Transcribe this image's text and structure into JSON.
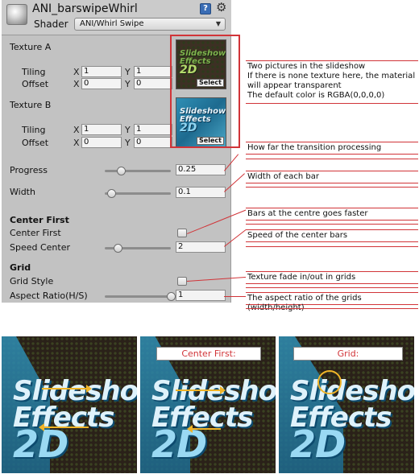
{
  "header": {
    "title": "ANI_barswipeWhirl",
    "shader_label": "Shader",
    "shader_value": "ANI/Whirl Swipe",
    "help_icon": "help-book-icon",
    "gear_icon": "gear-icon"
  },
  "texture_a": {
    "label": "Texture A",
    "tiling_label": "Tiling",
    "offset_label": "Offset",
    "axis_x": "X",
    "axis_y": "Y",
    "tiling_x": "1",
    "tiling_y": "1",
    "offset_x": "0",
    "offset_y": "0",
    "select_label": "Select",
    "thumb_text": "Slideshow Effects",
    "thumb_number": "2D"
  },
  "texture_b": {
    "label": "Texture B",
    "tiling_label": "Tiling",
    "offset_label": "Offset",
    "axis_x": "X",
    "axis_y": "Y",
    "tiling_x": "1",
    "tiling_y": "1",
    "offset_x": "0",
    "offset_y": "0",
    "select_label": "Select",
    "thumb_text": "Slideshow Effects",
    "thumb_number": "2D"
  },
  "progress": {
    "label": "Progress",
    "value": "0.25",
    "fraction": 0.25
  },
  "width": {
    "label": "Width",
    "value": "0.1",
    "fraction": 0.1
  },
  "center_first": {
    "section": "Center First",
    "toggle_label": "Center First",
    "speed_label": "Speed Center",
    "speed_value": "2",
    "speed_fraction": 0.2
  },
  "grid": {
    "section": "Grid",
    "style_label": "Grid Style",
    "aspect_label": "Aspect Ratio(H/S)",
    "aspect_value": "1",
    "aspect_fraction": 1.0
  },
  "notes": {
    "textures": "Two pictures in the slideshow\nIf there is none texture here, the material will appear transparent\nThe default color is RGBA(0,0,0,0)",
    "progress": "How far the transition processing",
    "width": "Width of each bar",
    "center_first": "Bars at the centre goes faster",
    "speed_center": "Speed of the center bars",
    "grid_style": "Texture fade in/out in grids",
    "aspect": "The aspect ratio of the grids (width/height)"
  },
  "previews": {
    "caption_center": "Center First:",
    "caption_grid": "Grid:",
    "logo_text": "Slideshow Effects",
    "logo_number": "2D"
  },
  "colors": {
    "annotation": "#d13438",
    "arrow": "#f0b428",
    "panel": "#c2c2c2"
  }
}
